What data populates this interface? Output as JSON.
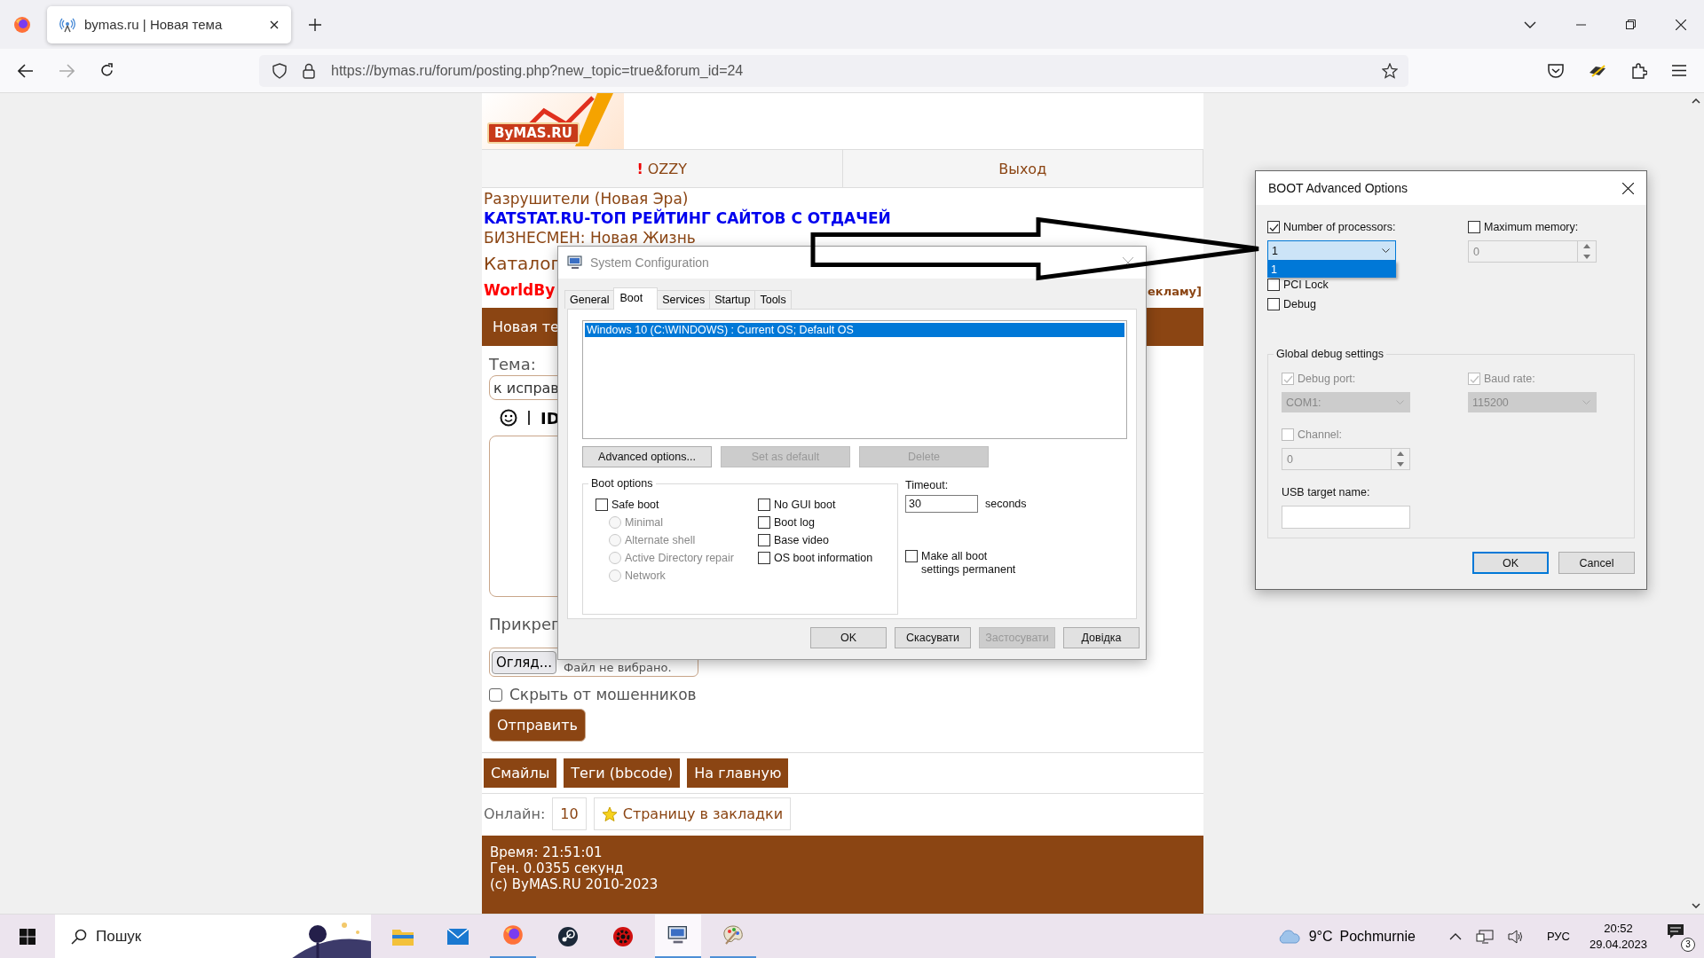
{
  "browser": {
    "tab": {
      "title": "bymas.ru | Новая тема",
      "selected": true
    },
    "url": "https://bymas.ru/forum/posting.php?new_topic=true&forum_id=24"
  },
  "forum": {
    "logo": "ByMAS.RU",
    "nav": [
      {
        "mark": "!",
        "label": "OZZY"
      },
      {
        "label": "Выход"
      }
    ],
    "links": [
      {
        "kind": "plain",
        "text": "Разрушители (Новая Эра)"
      },
      {
        "kind": "promo",
        "text": "KATSTAT.RU-ТОП РЕЙТИНГ САЙТОВ С ОТДАЧЕЙ"
      },
      {
        "kind": "plain",
        "text": "БИЗНЕСМЕН: Новая Жизнь"
      }
    ],
    "catalog": "Каталог",
    "worldby": "WorldBy",
    "ad_link": "екламу]",
    "section_bar": "Новая те",
    "topic_label": "Тема:",
    "topic_value": "к исправ",
    "toolbar_text": "ID",
    "attach_label": "Прикреп",
    "browse_button": "Огляд...",
    "file_status": "Файл не вибрано.",
    "hide_checkbox": {
      "label": "Скрыть от мошенников",
      "checked": false
    },
    "submit": "Отправить",
    "bottom_buttons": [
      "Смайлы",
      "Теги (bbcode)",
      "На главную"
    ],
    "online_label": "Онлайн:",
    "online_count": "10",
    "bookmark": "Страницу в закладки",
    "footer": [
      "Время: 21:51:01",
      "Ген. 0.0355 секунд",
      "(c) ByMAS.RU 2010-2023"
    ]
  },
  "msconfig": {
    "title": "System Configuration",
    "tabs": [
      {
        "label": "General",
        "selected": false
      },
      {
        "label": "Boot",
        "selected": true
      },
      {
        "label": "Services",
        "selected": false
      },
      {
        "label": "Startup",
        "selected": false
      },
      {
        "label": "Tools",
        "selected": false
      }
    ],
    "os_entries": [
      {
        "text": "Windows 10 (C:\\WINDOWS) : Current OS; Default OS",
        "selected": true
      }
    ],
    "actions": [
      {
        "label": "Advanced options...",
        "disabled": false
      },
      {
        "label": "Set as default",
        "disabled": true
      },
      {
        "label": "Delete",
        "disabled": true
      }
    ],
    "boot_options": {
      "title": "Boot options",
      "safe_boot": {
        "label": "Safe boot",
        "checked": false
      },
      "modes": [
        {
          "label": "Minimal",
          "selected": false,
          "disabled": true
        },
        {
          "label": "Alternate shell",
          "selected": false,
          "disabled": true
        },
        {
          "label": "Active Directory repair",
          "selected": false,
          "disabled": true
        },
        {
          "label": "Network",
          "selected": false,
          "disabled": true
        }
      ],
      "flags": [
        {
          "label": "No GUI boot",
          "checked": false
        },
        {
          "label": "Boot log",
          "checked": false
        },
        {
          "label": "Base video",
          "checked": false
        },
        {
          "label": "OS boot information",
          "checked": false
        }
      ]
    },
    "timeout": {
      "label": "Timeout:",
      "value": "30",
      "unit": "seconds"
    },
    "permanent": {
      "label": "Make all boot settings permanent",
      "checked": false
    },
    "buttons": [
      {
        "label": "OK",
        "disabled": false
      },
      {
        "label": "Скасувати",
        "disabled": false
      },
      {
        "label": "Застосувати",
        "disabled": true
      },
      {
        "label": "Довідка",
        "disabled": false
      }
    ]
  },
  "advanced": {
    "title": "BOOT Advanced Options",
    "processors": {
      "label": "Number of processors:",
      "checked": true,
      "value": "1",
      "expanded": true,
      "options": [
        {
          "label": "1",
          "selected": true
        }
      ]
    },
    "max_memory": {
      "label": "Maximum memory:",
      "checked": false,
      "value": "0"
    },
    "pci_lock": {
      "label": "PCI Lock",
      "checked": false
    },
    "debug": {
      "label": "Debug",
      "checked": false
    },
    "global": {
      "title": "Global debug settings",
      "debug_port": {
        "label": "Debug port:",
        "checked": true,
        "disabled": true,
        "value": "COM1:"
      },
      "baud_rate": {
        "label": "Baud rate:",
        "checked": true,
        "disabled": true,
        "value": "115200"
      },
      "channel": {
        "label": "Channel:",
        "checked": false,
        "disabled": true,
        "value": "0"
      },
      "usb_label": "USB target name:"
    },
    "buttons": [
      {
        "label": "OK",
        "default": true
      },
      {
        "label": "Cancel",
        "default": false
      }
    ]
  },
  "taskbar": {
    "search_placeholder": "Пошук",
    "apps": [
      {
        "kind": "explorer",
        "running": false,
        "selected": false
      },
      {
        "kind": "mail",
        "running": false,
        "selected": false
      },
      {
        "kind": "firefox",
        "running": true,
        "selected": false
      },
      {
        "kind": "steam",
        "running": false,
        "selected": false
      },
      {
        "kind": "gear",
        "running": false,
        "selected": false
      },
      {
        "kind": "msconfig",
        "running": true,
        "selected": true
      },
      {
        "kind": "paint",
        "running": true,
        "selected": false
      }
    ],
    "weather": {
      "temp": "9°C",
      "text": "Pochmurnie"
    },
    "language": "РУС",
    "time": "20:52",
    "date": "29.04.2023",
    "notifications": "3"
  }
}
